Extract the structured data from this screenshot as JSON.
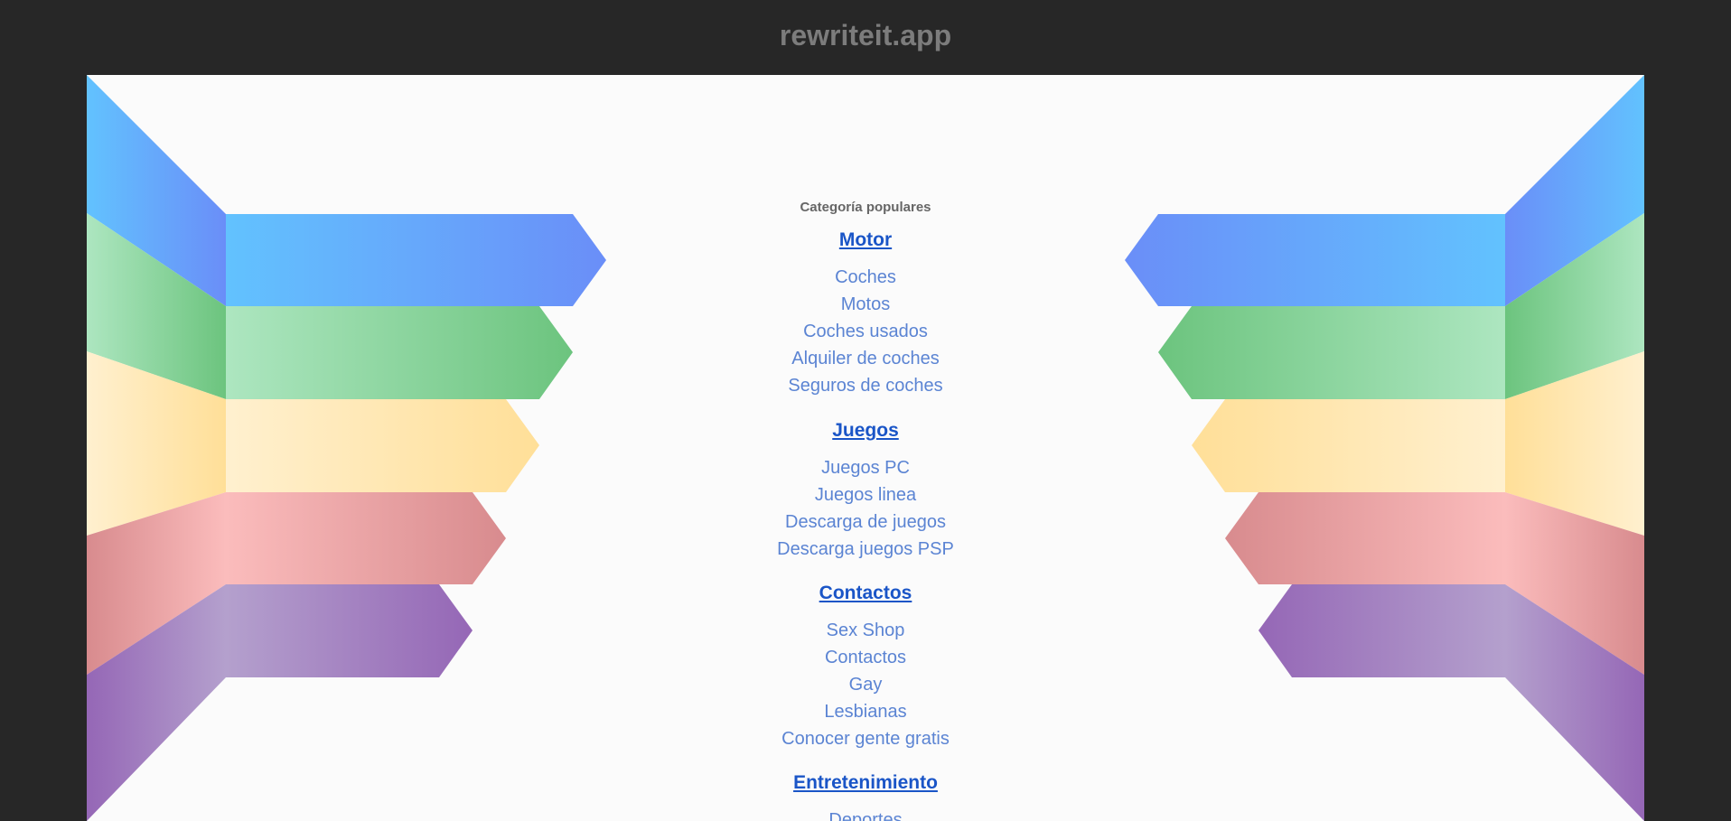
{
  "site": {
    "domain": "rewriteit.app"
  },
  "heading": "Categoría populares",
  "groups": [
    {
      "title": "Motor",
      "links": [
        "Coches",
        "Motos",
        "Coches usados",
        "Alquiler de coches",
        "Seguros de coches"
      ]
    },
    {
      "title": "Juegos",
      "links": [
        "Juegos PC",
        "Juegos linea",
        "Descarga de juegos",
        "Descarga juegos PSP"
      ]
    },
    {
      "title": "Contactos",
      "links": [
        "Sex Shop",
        "Contactos",
        "Gay",
        "Lesbianas",
        "Conocer gente gratis"
      ]
    },
    {
      "title": "Entretenimiento",
      "links": [
        "Deportes"
      ]
    }
  ],
  "colors": {
    "page_background": "#272727",
    "panel_background": "#fbfbfb",
    "title_text": "#7c7c7c",
    "category_link": "#1a55c7",
    "sub_link": "#5b84d3",
    "stripe_blue": "#62bcfd",
    "stripe_green": "#6cc47e",
    "stripe_yellow": "#ffe5a0",
    "stripe_red": "#f6b3b3",
    "stripe_purple": "#9a6db8"
  }
}
